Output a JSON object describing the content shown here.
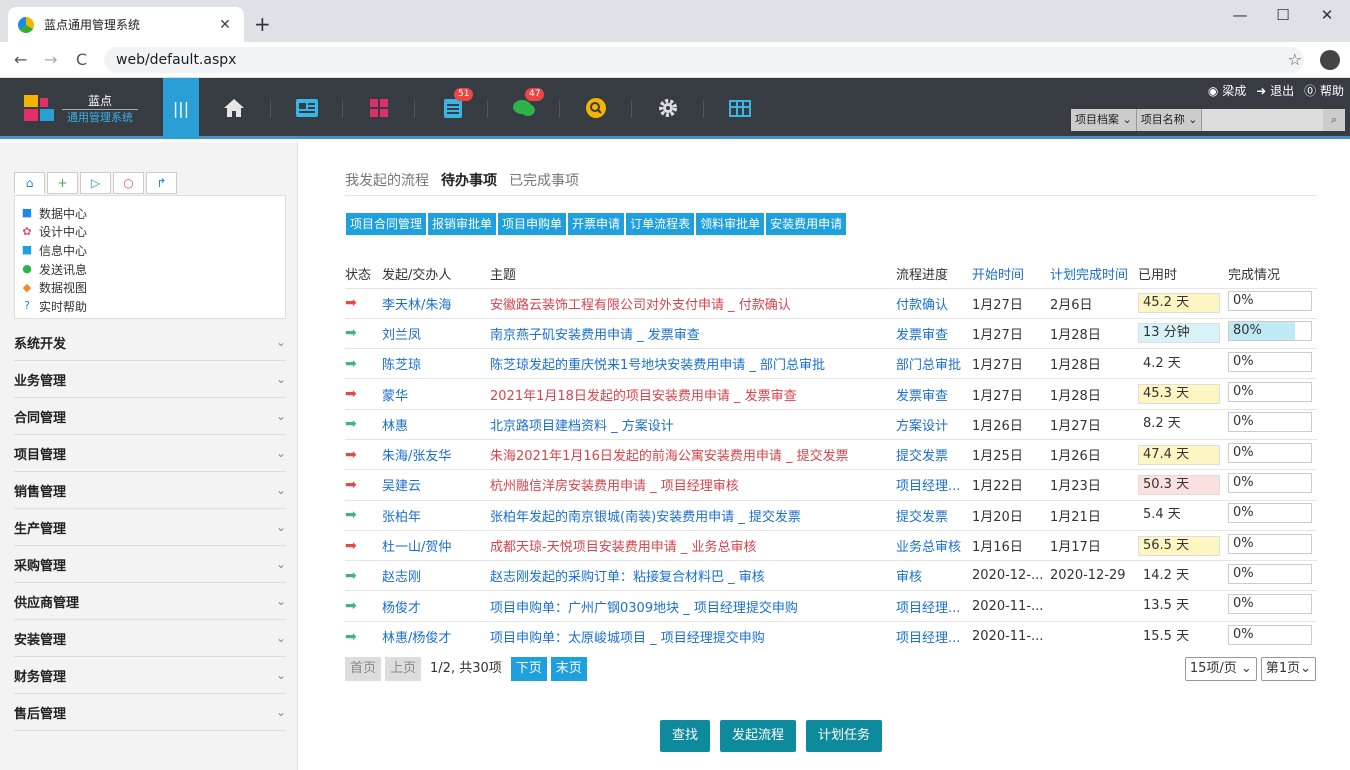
{
  "browser": {
    "tab_title": "蓝点通用管理系统",
    "tab_close": "✕",
    "new_tab": "+",
    "url": "web/default.aspx",
    "win_min": "—",
    "win_max": "☐",
    "win_close": "✕",
    "back": "←",
    "forward": "→",
    "reload": "C",
    "star": "☆"
  },
  "header": {
    "logo_title": "蓝点",
    "logo_sub": "通用管理系统",
    "menu_toggle": "|||",
    "badges": {
      "tasks": "51",
      "messages": "47"
    },
    "user_links": {
      "user": "梁成",
      "logout": "退出",
      "help": "帮助"
    },
    "user_icons": {
      "user": "◉",
      "logout": "➜",
      "help": "⓪"
    },
    "search": {
      "scope": "项目档案",
      "field": "项目名称",
      "scope_arrow": "⌄",
      "field_arrow": "⌄",
      "mag": "⌕"
    },
    "colors": {
      "bar": "#373b42",
      "accent": "#2a9fd6"
    }
  },
  "sidebar": {
    "quick_tabs": [
      {
        "icon": "home-icon",
        "glyph": "⌂"
      },
      {
        "icon": "plus-icon",
        "glyph": "+"
      },
      {
        "icon": "play-icon",
        "glyph": "▷"
      },
      {
        "icon": "search-icon",
        "glyph": "○"
      },
      {
        "icon": "share-icon",
        "glyph": "↱"
      }
    ],
    "quick_items": [
      {
        "label": "数据中心",
        "icon": "grid-icon",
        "glyph": "■",
        "color": "#1e88e5"
      },
      {
        "label": "设计中心",
        "icon": "palette-icon",
        "glyph": "✿",
        "color": "#e0556a"
      },
      {
        "label": "信息中心",
        "icon": "newspaper-icon",
        "glyph": "■",
        "color": "#1e9fde"
      },
      {
        "label": "发送讯息",
        "icon": "chat-icon",
        "glyph": "●",
        "color": "#2db34a"
      },
      {
        "label": "数据视图",
        "icon": "layers-icon",
        "glyph": "◆",
        "color": "#f08a24"
      },
      {
        "label": "实时帮助",
        "icon": "help-icon",
        "glyph": "?",
        "color": "#1e88e5"
      }
    ],
    "menu_groups": [
      "系统开发",
      "业务管理",
      "合同管理",
      "项目管理",
      "销售管理",
      "生产管理",
      "采购管理",
      "供应商管理",
      "安装管理",
      "财务管理",
      "售后管理"
    ],
    "chevron": "⌄"
  },
  "main": {
    "page_tabs": [
      "我发起的流程",
      "待办事项",
      "已完成事项"
    ],
    "active_tab": 1,
    "filter_tabs": [
      "项目合同管理",
      "报销审批单",
      "项目申购单",
      "开票申请",
      "订单流程表",
      "领料审批单",
      "安装费用申请"
    ],
    "columns": [
      "状态",
      "发起/交办人",
      "主题",
      "流程进度",
      "开始时间",
      "计划完成时间",
      "已用时",
      "完成情况"
    ],
    "rows": [
      {
        "status": "red",
        "person": "李天林/朱海",
        "subject": "安徽路云装饰工程有限公司对外支付申请 _ 付款确认",
        "step": "付款确认",
        "start": "1月27日",
        "due": "2月6日",
        "elapsed": "45.2 天",
        "elapsed_bg": "#fdf6c3",
        "done": "0%",
        "done_pct": 0
      },
      {
        "status": "green",
        "person": "刘兰凤",
        "subject": "南京燕子矶安装费用申请 _ 发票审查",
        "step": "发票审查",
        "start": "1月27日",
        "due": "1月28日",
        "elapsed": "13 分钟",
        "elapsed_bg": "#d8f3f8",
        "done": "80%",
        "done_pct": 80
      },
      {
        "status": "green",
        "person": "陈芝琼",
        "subject": "陈芝琼发起的重庆悦来1号地块安装费用申请 _ 部门总审批",
        "step": "部门总审批",
        "start": "1月27日",
        "due": "1月28日",
        "elapsed": "4.2 天",
        "elapsed_bg": "",
        "done": "0%",
        "done_pct": 0
      },
      {
        "status": "red",
        "person": "蒙华",
        "subject": "2021年1月18日发起的项目安装费用申请 _ 发票审查",
        "step": "发票审查",
        "start": "1月27日",
        "due": "1月28日",
        "elapsed": "45.3 天",
        "elapsed_bg": "#fdf6c3",
        "done": "0%",
        "done_pct": 0
      },
      {
        "status": "green",
        "person": "林惠",
        "subject": "北京路项目建档资料 _ 方案设计",
        "step": "方案设计",
        "start": "1月26日",
        "due": "1月27日",
        "elapsed": "8.2 天",
        "elapsed_bg": "",
        "done": "0%",
        "done_pct": 0
      },
      {
        "status": "red",
        "person": "朱海/张友华",
        "subject": "朱海2021年1月16日发起的前海公寓安装费用申请 _ 提交发票",
        "step": "提交发票",
        "start": "1月25日",
        "due": "1月26日",
        "elapsed": "47.4 天",
        "elapsed_bg": "#fdf6c3",
        "done": "0%",
        "done_pct": 0
      },
      {
        "status": "red",
        "person": "吴建云",
        "subject": "杭州融信洋房安装费用申请 _ 项目经理审核",
        "step": "项目经理...",
        "start": "1月22日",
        "due": "1月23日",
        "elapsed": "50.3 天",
        "elapsed_bg": "#fbe0e0",
        "done": "0%",
        "done_pct": 0
      },
      {
        "status": "green",
        "person": "张柏年",
        "subject": "张柏年发起的南京银城(南装)安装费用申请 _ 提交发票",
        "step": "提交发票",
        "start": "1月20日",
        "due": "1月21日",
        "elapsed": "5.4 天",
        "elapsed_bg": "",
        "done": "0%",
        "done_pct": 0
      },
      {
        "status": "red",
        "person": "杜一山/贺仲",
        "subject": "成都天琼-天悦项目安装费用申请 _ 业务总审核",
        "step": "业务总审核",
        "start": "1月16日",
        "due": "1月17日",
        "elapsed": "56.5 天",
        "elapsed_bg": "#fdf6c3",
        "done": "0%",
        "done_pct": 0
      },
      {
        "status": "green",
        "person": "赵志刚",
        "subject": "赵志刚发起的采购订单：粘接复合材料巴 _ 审核",
        "step": "审核",
        "start": "2020-12-...",
        "due": "2020-12-29",
        "elapsed": "14.2 天",
        "elapsed_bg": "",
        "done": "0%",
        "done_pct": 0
      },
      {
        "status": "green",
        "person": "杨俊才",
        "subject": "项目申购单：广州广钢0309地块 _ 项目经理提交申购",
        "step": "项目经理...",
        "start": "2020-11-...",
        "due": "",
        "elapsed": "13.5 天",
        "elapsed_bg": "",
        "done": "0%",
        "done_pct": 0
      },
      {
        "status": "green",
        "person": "林惠/杨俊才",
        "subject": "项目申购单：太原峻城项目 _ 项目经理提交申购",
        "step": "项目经理...",
        "start": "2020-11-...",
        "due": "",
        "elapsed": "15.5 天",
        "elapsed_bg": "",
        "done": "0%",
        "done_pct": 0
      }
    ],
    "status_colors": {
      "red": "#e24a4a",
      "green": "#3cb878"
    },
    "arrow_glyph": "➡",
    "pager": {
      "first": "首页",
      "prev": "上页",
      "info": "1/2, 共30项",
      "next": "下页",
      "last": "末页"
    },
    "page_size": "15项/页 ⌄",
    "page_num": "第1页⌄",
    "actions": [
      "查找",
      "发起流程",
      "计划任务"
    ]
  }
}
